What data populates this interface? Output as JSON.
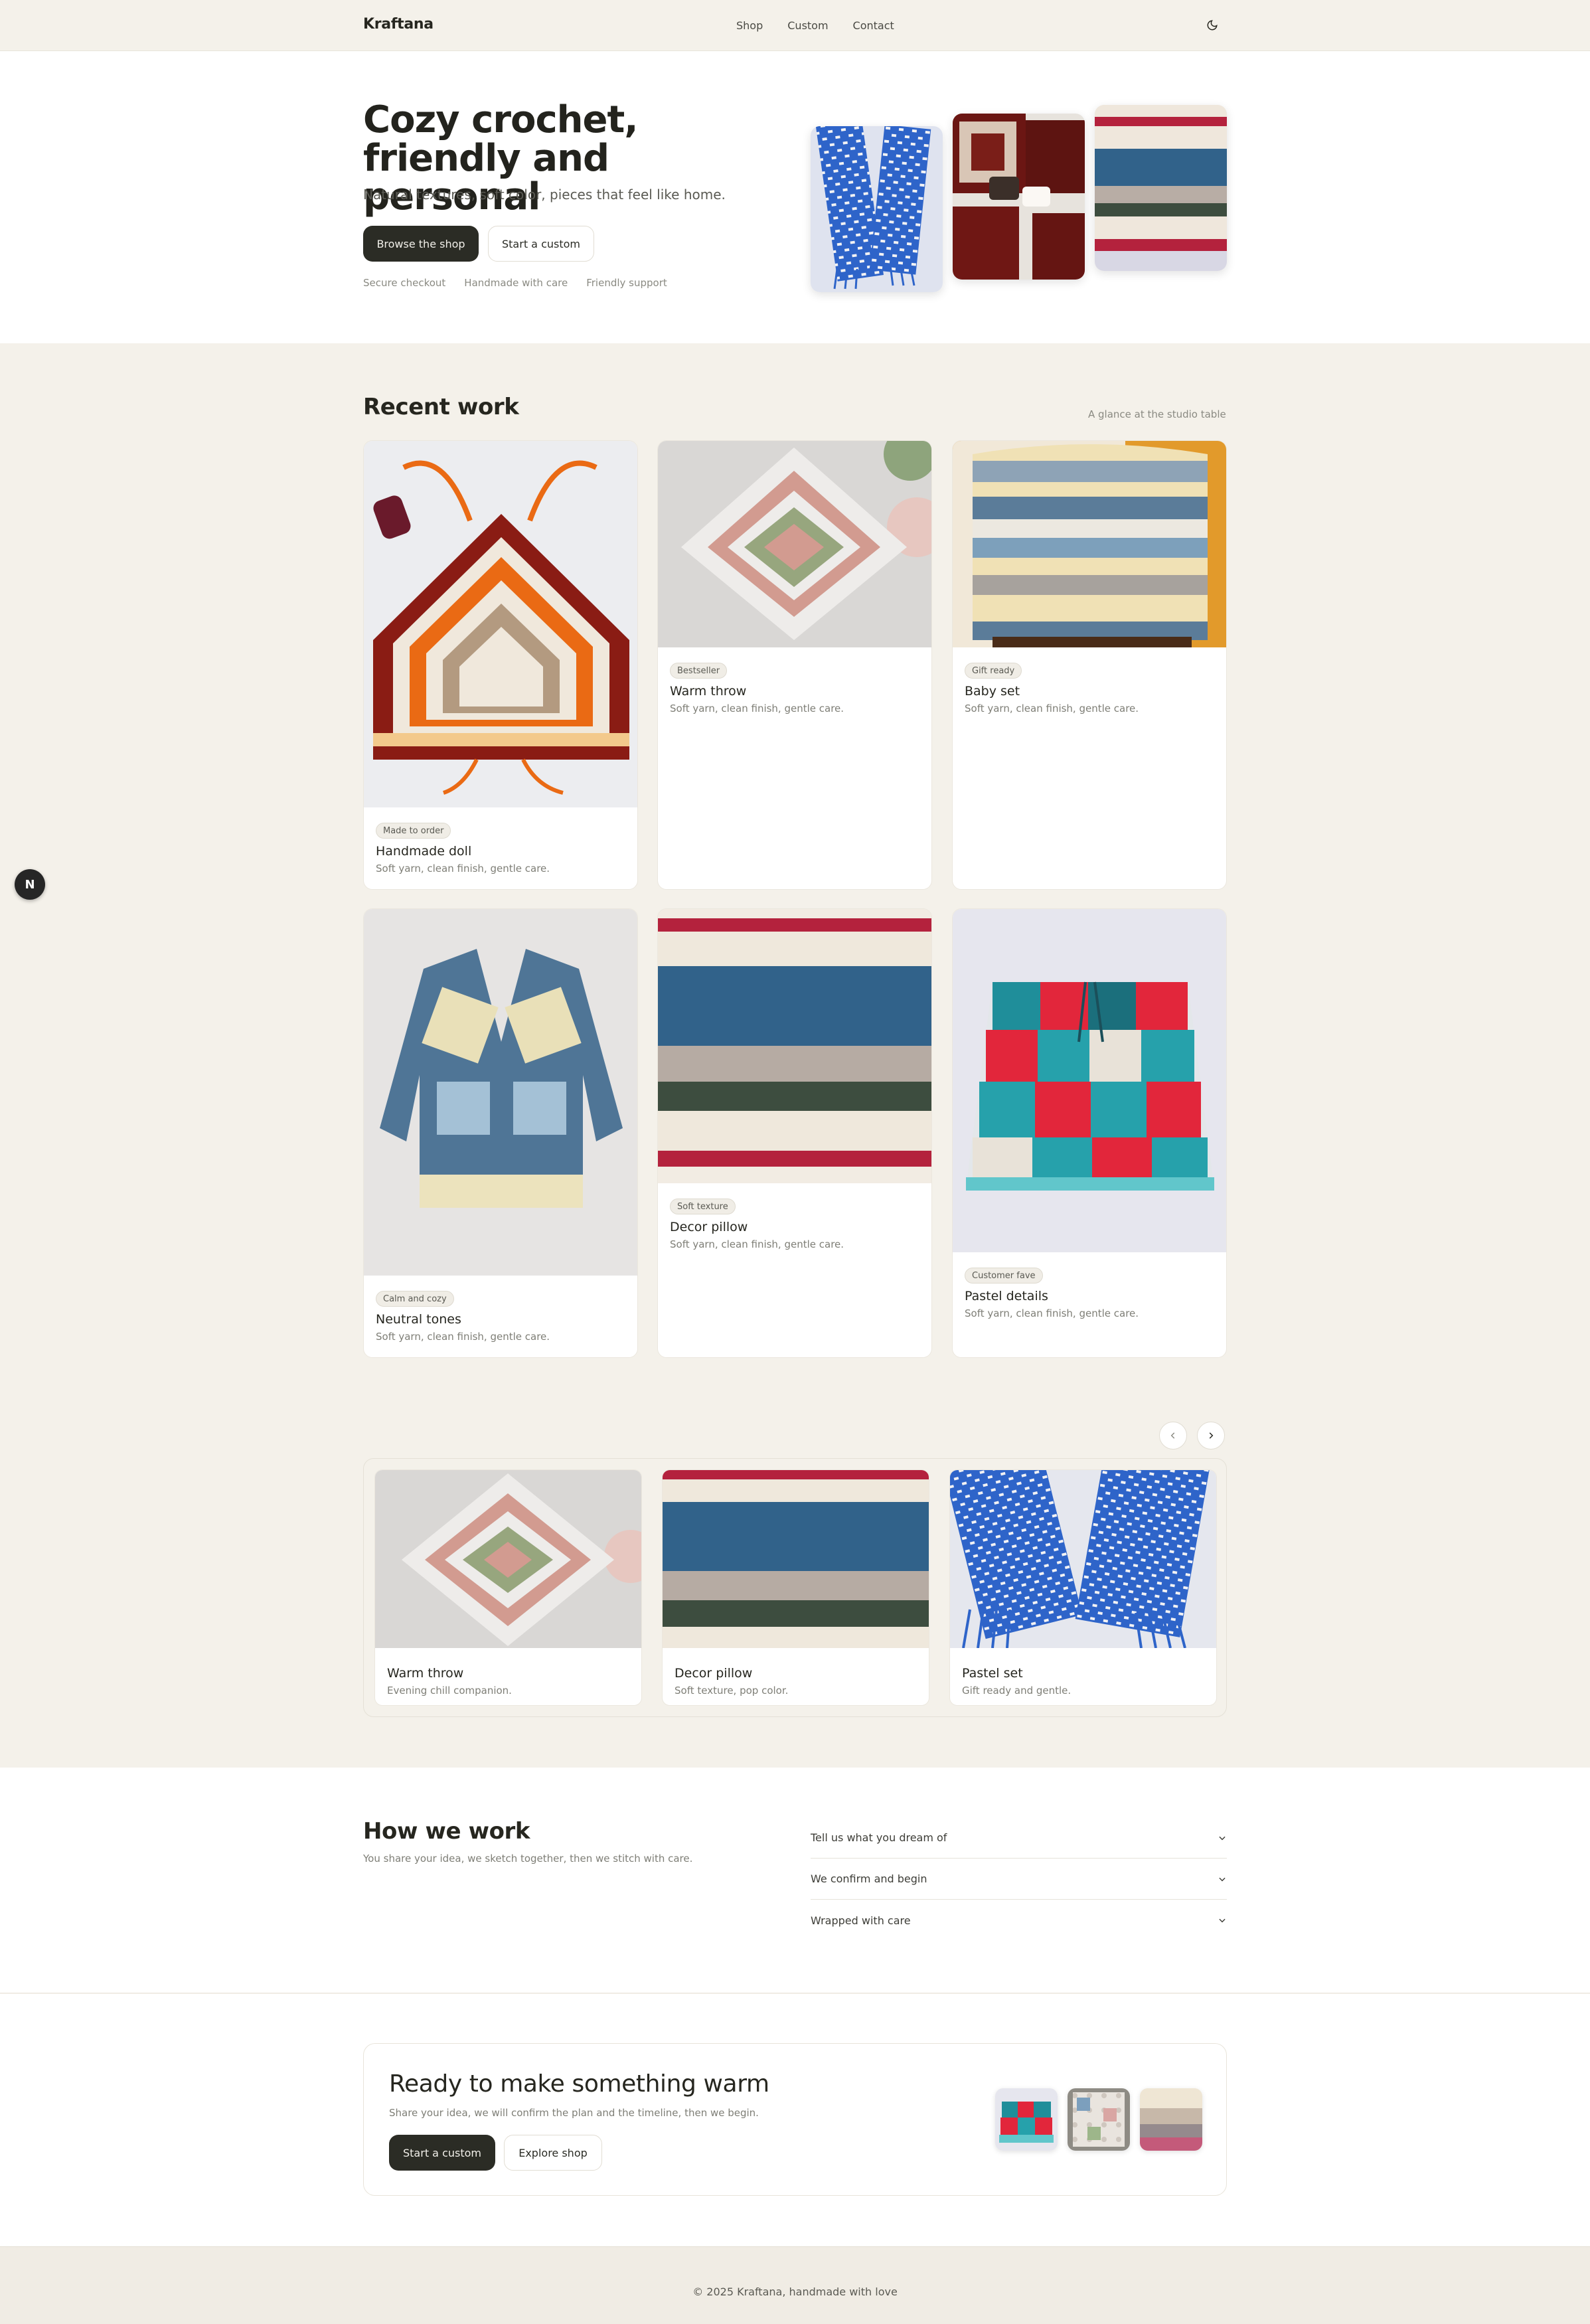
{
  "header": {
    "logo": "Kraftana",
    "nav": [
      "Shop",
      "Custom",
      "Contact"
    ],
    "theme_icon": "moon-icon"
  },
  "hero": {
    "title": "Cozy crochet, friendly and personal",
    "subtitle": "Natural textures, soft color, pieces that feel like home.",
    "primary_button": "Browse the shop",
    "secondary_button": "Start a custom",
    "trust": [
      "Secure checkout",
      "Handmade with care",
      "Friendly support"
    ]
  },
  "recent": {
    "title": "Recent work",
    "note": "A glance at the studio table",
    "cards": [
      {
        "badge": "Made to order",
        "title": "Handmade doll",
        "desc": "Soft yarn, clean finish, gentle care."
      },
      {
        "badge": "Bestseller",
        "title": "Warm throw",
        "desc": "Soft yarn, clean finish, gentle care."
      },
      {
        "badge": "Gift ready",
        "title": "Baby set",
        "desc": "Soft yarn, clean finish, gentle care."
      },
      {
        "badge": "Calm and cozy",
        "title": "Neutral tones",
        "desc": "Soft yarn, clean finish, gentle care."
      },
      {
        "badge": "Soft texture",
        "title": "Decor pillow",
        "desc": "Soft yarn, clean finish, gentle care."
      },
      {
        "badge": "Customer fave",
        "title": "Pastel details",
        "desc": "Soft yarn, clean finish, gentle care."
      }
    ]
  },
  "carousel": {
    "prev_icon": "chevron-left-icon",
    "next_icon": "chevron-right-icon",
    "items": [
      {
        "title": "Warm throw",
        "desc": "Evening chill companion."
      },
      {
        "title": "Decor pillow",
        "desc": "Soft texture, pop color."
      },
      {
        "title": "Pastel set",
        "desc": "Gift ready and gentle."
      }
    ]
  },
  "how": {
    "title": "How we work",
    "subtitle": "You share your idea, we sketch together, then we stitch with care.",
    "steps": [
      "Tell us what you dream of",
      "We confirm and begin",
      "Wrapped with care"
    ]
  },
  "cta": {
    "title": "Ready to make something warm",
    "subtitle": "Share your idea, we will confirm the plan and the timeline, then we begin.",
    "primary_button": "Start a custom",
    "secondary_button": "Explore shop"
  },
  "footer": {
    "text": "© 2025 Kraftana, handmade with love"
  },
  "dev_badge": "N"
}
